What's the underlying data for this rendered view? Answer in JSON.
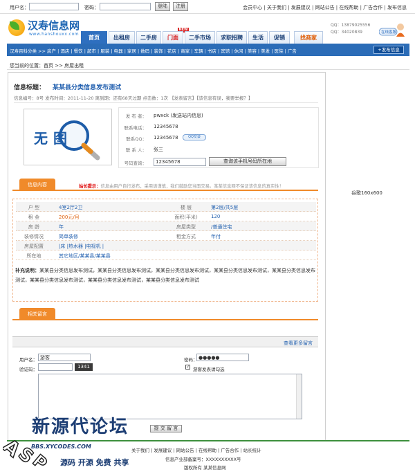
{
  "topbar": {
    "username_label": "用户名：",
    "password_label": "密码：",
    "login_btn": "登陆",
    "register_btn": "注册",
    "links": "会员中心 | 关于我们 | 发展建议 | 网站公告 | 在线帮助 | 广告合作 | 发布信息"
  },
  "header": {
    "logo_text": "汉寿信息网",
    "logo_url": "www.hanshouxx.com",
    "qq_line1": "QQ：13879025556",
    "qq_line2": "QQ：34020839",
    "service_label": "在线客服",
    "new_badge": "NEW",
    "nav": [
      "首页",
      "出租房",
      "二手房",
      "门面",
      "二手市场",
      "求职招聘",
      "生活",
      "促销",
      "找商家"
    ]
  },
  "subnav": {
    "items": "汉寿百科分类 >>  房产 | 酒店 | 餐饮 | 超市 | 服装 | 电器 | 家居 | 数码 | 装饰 | 花店 | 商家 | 车辆 | 书店 | 宾馆 | 休闲 | 美容 | 美发 | 医院 | 广告",
    "post_btn": "+发布信息"
  },
  "breadcrumb": "您当前的位置：首页 >> 房屋出租",
  "listing": {
    "title_label": "信息标题：",
    "title": "某某县分类信息发布测试",
    "meta": "信息编号：8号  发布时间：2011-11-20  离到期：还有68天过期  点击数：1次  【发表留言】【该信息有误，我要举报？】",
    "photo_text": "无图",
    "contact": {
      "publisher_label": "发 布 者：",
      "publisher": "pwxck (发送站内信息)",
      "phone_label": "联系电话：",
      "phone": "12345678",
      "qq_label": "联系QQ：",
      "qq": "12345678",
      "qq_badge": "QQ交谈",
      "person_label": "联 系 人：",
      "person": "张三",
      "lookup_label": "号码查询：",
      "lookup_value": "12345678",
      "lookup_btn": "查询该手机号码所在地"
    }
  },
  "tabs": {
    "detail": "信息内容",
    "comments": "相关留言"
  },
  "notice": {
    "head": "站长提示：",
    "text": "信息由用户自行发布，采用请谨慎，我们鼓励您当面交易。某某信息网不保证该信息的真实性！"
  },
  "details": {
    "rows": [
      {
        "l1": "户  型",
        "v1": "4室2厅2卫",
        "l2": "楼  层",
        "v2": "第2层/共5层"
      },
      {
        "l1": "租  金",
        "v1": "200元/月",
        "l2": "面积(平米)",
        "v2": "120"
      },
      {
        "l1": "房  龄",
        "v1": "年",
        "l2": "房屋类型",
        "v2": "/普通住宅"
      },
      {
        "l1": "装修情况",
        "v1": "简单装修",
        "l2": "租金方式",
        "v2": "年付"
      },
      {
        "l1": "房屋配置",
        "v1": "|床    |热水器    |电视机    |",
        "l2": "",
        "v2": ""
      },
      {
        "l1": "所在地",
        "v1": "其它地区/某某县/某某县",
        "l2": "",
        "v2": ""
      }
    ],
    "note_label": "补充说明：",
    "note_text": "某某县分类信息发布测试，某某县分类信息发布测试，某某县分类信息发布测试，某某县分类信息发布测试，某某县分类信息发布测试，某某县分类信息发布测试，某某县分类信息发布测试，某某县分类信息发布测试"
  },
  "comments": {
    "more": "查看更多留言",
    "user_label": "用户名：",
    "user_value": "游客",
    "pass_label": "密码：",
    "pass_value": "●●●●●",
    "captcha_label": "验证码：",
    "captcha_code": "1341",
    "guest_check": "游客发表请勾选",
    "submit": "提 交 留 言"
  },
  "ad": "谷歌160x600",
  "footer": {
    "links": "关于我们 | 发展建议 | 网站公告 | 在线帮助 | 广告合作 | 站长统计",
    "icp": "信息产业部备案号：XXXXXXXXXX号",
    "copyright": "版权所有 某某信息网"
  },
  "watermark": {
    "title": "新源代论坛",
    "url": "BBS.XYCODES.COM",
    "slogan": "源码 开源 免费 共享"
  },
  "colors": {
    "brand_blue": "#2b6cb7",
    "link_blue": "#2562b0",
    "tab_orange": "#f08a2a",
    "price_orange": "#e0600a"
  }
}
